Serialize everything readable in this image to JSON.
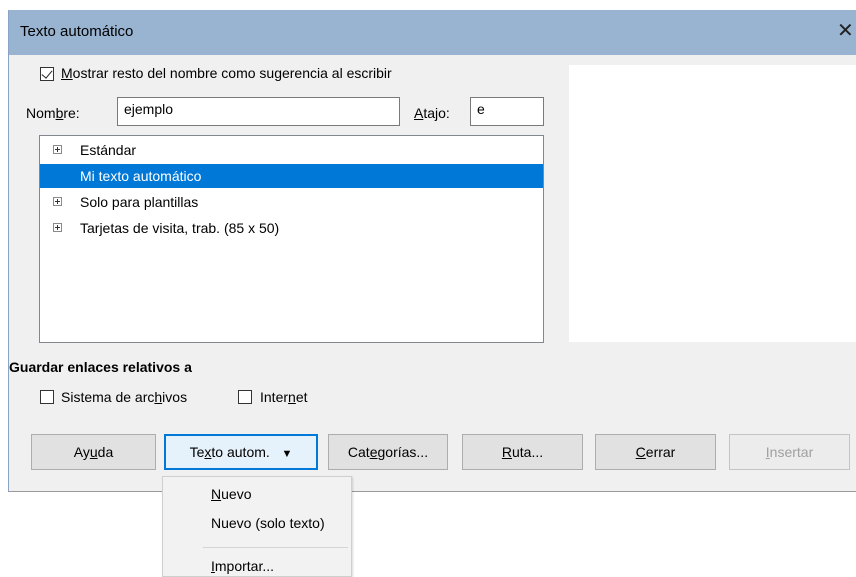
{
  "window": {
    "title": "Texto automático"
  },
  "options": {
    "show_suggestion": {
      "pre": "",
      "mnemonic": "M",
      "post": "ostrar resto del nombre como sugerencia al escribir",
      "checked": true
    }
  },
  "name_field": {
    "label_pre": "Nom",
    "label_mnemonic": "b",
    "label_post": "re:",
    "value": "ejemplo"
  },
  "shortcut_field": {
    "label_pre": "",
    "label_mnemonic": "A",
    "label_post": "tajo:",
    "value": "e"
  },
  "categories": [
    {
      "label": "Estándar",
      "expandable": true,
      "selected": false
    },
    {
      "label": "Mi texto automático",
      "expandable": false,
      "selected": true
    },
    {
      "label": "Solo para plantillas",
      "expandable": true,
      "selected": false
    },
    {
      "label": "Tarjetas de visita, trab. (85 x 50)",
      "expandable": true,
      "selected": false
    }
  ],
  "relative_links": {
    "heading": "Guardar enlaces relativos a",
    "filesystem": {
      "pre": "Sistema de arc",
      "mnemonic": "h",
      "post": "ivos",
      "checked": false
    },
    "internet": {
      "pre": "Inter",
      "mnemonic": "n",
      "post": "et",
      "checked": false
    }
  },
  "buttons": {
    "help": {
      "pre": "Ay",
      "mnemonic": "u",
      "post": "da"
    },
    "autotext": {
      "pre": "Te",
      "mnemonic": "x",
      "post": "to autom.",
      "arrow": "▼"
    },
    "categories": {
      "pre": "Cat",
      "mnemonic": "e",
      "post": "gorías..."
    },
    "path": {
      "pre": "",
      "mnemonic": "R",
      "post": "uta..."
    },
    "close": {
      "pre": "",
      "mnemonic": "C",
      "post": "errar"
    },
    "insert": {
      "pre": "",
      "mnemonic": "I",
      "post": "nsertar"
    }
  },
  "close_glyph": "✕",
  "menu": {
    "new": {
      "pre": "",
      "mnemonic": "N",
      "post": "uevo"
    },
    "new_text_only": {
      "label": "Nuevo (solo texto)"
    },
    "import": {
      "pre": "",
      "mnemonic": "I",
      "post": "mportar..."
    }
  },
  "colors": {
    "titlebar": "#99b4d1",
    "selection": "#0078d7",
    "button_focus": "#0078d7"
  }
}
